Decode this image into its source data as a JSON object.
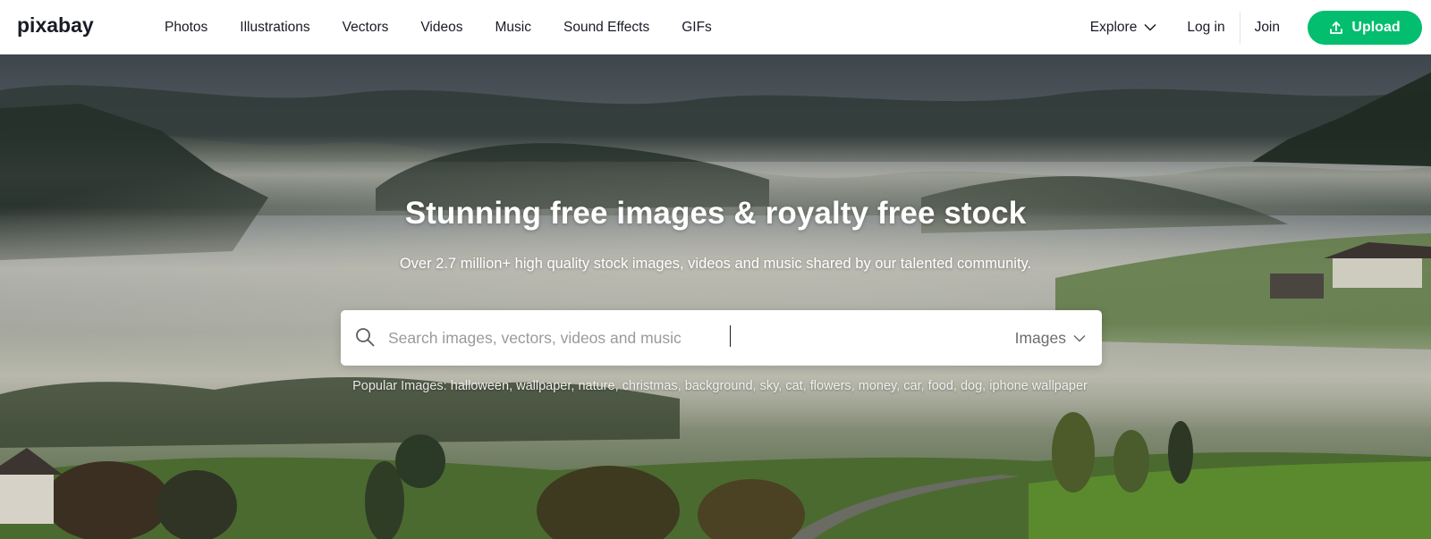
{
  "header": {
    "logo_text": "pixabay",
    "nav": [
      "Photos",
      "Illustrations",
      "Vectors",
      "Videos",
      "Music",
      "Sound Effects",
      "GIFs"
    ],
    "explore_label": "Explore",
    "login_label": "Log in",
    "join_label": "Join",
    "upload_label": "Upload"
  },
  "hero": {
    "title": "Stunning free images & royalty free stock",
    "subtitle": "Over 2.7 million+ high quality stock images, videos and music shared by our talented community.",
    "search": {
      "placeholder": "Search images, vectors, videos and music",
      "value": "",
      "type_selected": "Images"
    },
    "popular_label": "Popular Images:",
    "popular_tags": [
      "halloween",
      "wallpaper",
      "nature",
      "christmas",
      "background",
      "sky",
      "cat",
      "flowers",
      "money",
      "car",
      "food",
      "dog",
      "iphone wallpaper"
    ]
  },
  "colors": {
    "accent": "#02be6e",
    "text": "#191b26",
    "white": "#ffffff"
  },
  "icons": {
    "search": "search-icon",
    "explore_chevron": "chevron-down-icon",
    "upload": "upload-icon",
    "type_chevron": "chevron-down-icon"
  }
}
